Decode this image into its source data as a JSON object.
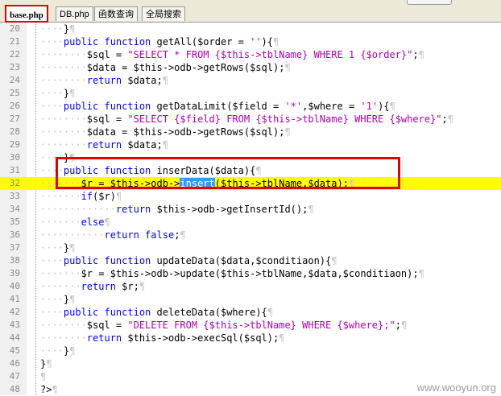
{
  "tabs": [
    {
      "label": "base.php",
      "active": true
    },
    {
      "label": "DB.php",
      "active": false
    },
    {
      "label": "函数查询",
      "active": false
    },
    {
      "label": "全局搜索",
      "active": false
    }
  ],
  "lines": [
    {
      "n": "20",
      "segs": [
        [
          "ws",
          "····"
        ],
        [
          "t",
          "}"
        ],
        [
          "pil",
          "¶"
        ]
      ]
    },
    {
      "n": "21",
      "segs": [
        [
          "ws",
          "····"
        ],
        [
          "k",
          "public function "
        ],
        [
          "t",
          "getAll($order = "
        ],
        [
          "s",
          "''"
        ],
        [
          "t",
          "){"
        ],
        [
          "pil",
          "¶"
        ]
      ]
    },
    {
      "n": "22",
      "segs": [
        [
          "ws",
          "········"
        ],
        [
          "t",
          "$sql = "
        ],
        [
          "s",
          "\"SELECT * FROM {$this->tblName} WHERE 1 {$order}\""
        ],
        [
          "t",
          ";"
        ],
        [
          "pil",
          "¶"
        ]
      ]
    },
    {
      "n": "23",
      "segs": [
        [
          "ws",
          "········"
        ],
        [
          "t",
          "$data = $this->odb->getRows($sql);"
        ],
        [
          "pil",
          "¶"
        ]
      ]
    },
    {
      "n": "24",
      "segs": [
        [
          "ws",
          "········"
        ],
        [
          "k",
          "return "
        ],
        [
          "t",
          "$data;"
        ],
        [
          "pil",
          "¶"
        ]
      ]
    },
    {
      "n": "25",
      "segs": [
        [
          "ws",
          "····"
        ],
        [
          "t",
          "}"
        ],
        [
          "pil",
          "¶"
        ]
      ]
    },
    {
      "n": "26",
      "segs": [
        [
          "ws",
          "····"
        ],
        [
          "k",
          "public function "
        ],
        [
          "t",
          "getDataLimit($field = "
        ],
        [
          "s",
          "'*'"
        ],
        [
          "t",
          ",$where = "
        ],
        [
          "s",
          "'1'"
        ],
        [
          "t",
          "){"
        ],
        [
          "pil",
          "¶"
        ]
      ]
    },
    {
      "n": "27",
      "segs": [
        [
          "ws",
          "········"
        ],
        [
          "t",
          "$sql = "
        ],
        [
          "s",
          "\"SELECT {$field} FROM {$this->tblName} WHERE {$where}\""
        ],
        [
          "t",
          ";"
        ],
        [
          "pil",
          "¶"
        ]
      ]
    },
    {
      "n": "28",
      "segs": [
        [
          "ws",
          "········"
        ],
        [
          "t",
          "$data = $this->odb->getRows($sql);"
        ],
        [
          "pil",
          "¶"
        ]
      ]
    },
    {
      "n": "29",
      "segs": [
        [
          "ws",
          "········"
        ],
        [
          "k",
          "return "
        ],
        [
          "t",
          "$data;"
        ],
        [
          "pil",
          "¶"
        ]
      ]
    },
    {
      "n": "30",
      "segs": [
        [
          "ws",
          "····"
        ],
        [
          "t",
          "}"
        ],
        [
          "pil",
          "¶"
        ]
      ]
    },
    {
      "n": "31",
      "segs": [
        [
          "ws",
          "····"
        ],
        [
          "k",
          "public function "
        ],
        [
          "t",
          "inserData($data){"
        ],
        [
          "pil",
          "¶"
        ]
      ]
    },
    {
      "n": "32",
      "hl": true,
      "segs": [
        [
          "ws",
          "·······"
        ],
        [
          "t",
          "$r = $this->odb->"
        ],
        [
          "sel",
          "insert"
        ],
        [
          "t",
          "($this->tblName,$data);"
        ],
        [
          "pil",
          "¶"
        ]
      ]
    },
    {
      "n": "33",
      "segs": [
        [
          "ws",
          "·······"
        ],
        [
          "k",
          "if"
        ],
        [
          "t",
          "($r)"
        ],
        [
          "pil",
          "¶"
        ]
      ]
    },
    {
      "n": "34",
      "segs": [
        [
          "ws",
          "·············"
        ],
        [
          "k",
          "return "
        ],
        [
          "t",
          "$this->odb->getInsertId();"
        ],
        [
          "pil",
          "¶"
        ]
      ]
    },
    {
      "n": "35",
      "segs": [
        [
          "ws",
          "·······"
        ],
        [
          "k",
          "else"
        ],
        [
          "pil",
          "¶"
        ]
      ]
    },
    {
      "n": "36",
      "segs": [
        [
          "ws",
          "···········"
        ],
        [
          "k",
          "return false"
        ],
        [
          "t",
          ";"
        ],
        [
          "pil",
          "¶"
        ]
      ]
    },
    {
      "n": "37",
      "segs": [
        [
          "ws",
          "····"
        ],
        [
          "t",
          "}"
        ],
        [
          "pil",
          "¶"
        ]
      ]
    },
    {
      "n": "38",
      "segs": [
        [
          "ws",
          "····"
        ],
        [
          "k",
          "public function "
        ],
        [
          "t",
          "updateData($data,$conditiaon){"
        ],
        [
          "pil",
          "¶"
        ]
      ]
    },
    {
      "n": "39",
      "segs": [
        [
          "ws",
          "·······"
        ],
        [
          "t",
          "$r = $this->odb->update($this->tblName,$data,$conditiaon);"
        ],
        [
          "pil",
          "¶"
        ]
      ]
    },
    {
      "n": "40",
      "segs": [
        [
          "ws",
          "·······"
        ],
        [
          "k",
          "return "
        ],
        [
          "t",
          "$r;"
        ],
        [
          "pil",
          "¶"
        ]
      ]
    },
    {
      "n": "41",
      "segs": [
        [
          "ws",
          "····"
        ],
        [
          "t",
          "}"
        ],
        [
          "pil",
          "¶"
        ]
      ]
    },
    {
      "n": "42",
      "segs": [
        [
          "ws",
          "····"
        ],
        [
          "k",
          "public function "
        ],
        [
          "t",
          "deleteData($where){"
        ],
        [
          "pil",
          "¶"
        ]
      ]
    },
    {
      "n": "43",
      "segs": [
        [
          "ws",
          "········"
        ],
        [
          "t",
          "$sql = "
        ],
        [
          "s",
          "\"DELETE FROM {$this->tblName} WHERE {$where};\""
        ],
        [
          "t",
          ";"
        ],
        [
          "pil",
          "¶"
        ]
      ]
    },
    {
      "n": "44",
      "segs": [
        [
          "ws",
          "········"
        ],
        [
          "k",
          "return "
        ],
        [
          "t",
          "$this->odb->execSql($sql);"
        ],
        [
          "pil",
          "¶"
        ]
      ]
    },
    {
      "n": "45",
      "segs": [
        [
          "ws",
          "····"
        ],
        [
          "t",
          "}"
        ],
        [
          "pil",
          "¶"
        ]
      ]
    },
    {
      "n": "46",
      "segs": [
        [
          "t",
          "}"
        ],
        [
          "pil",
          "¶"
        ]
      ]
    },
    {
      "n": "47",
      "segs": [
        [
          "pil",
          "¶"
        ]
      ]
    },
    {
      "n": "48",
      "segs": [
        [
          "t",
          "?>"
        ],
        [
          "pil",
          "¶"
        ]
      ]
    }
  ],
  "watermark": "www.wooyun.org"
}
